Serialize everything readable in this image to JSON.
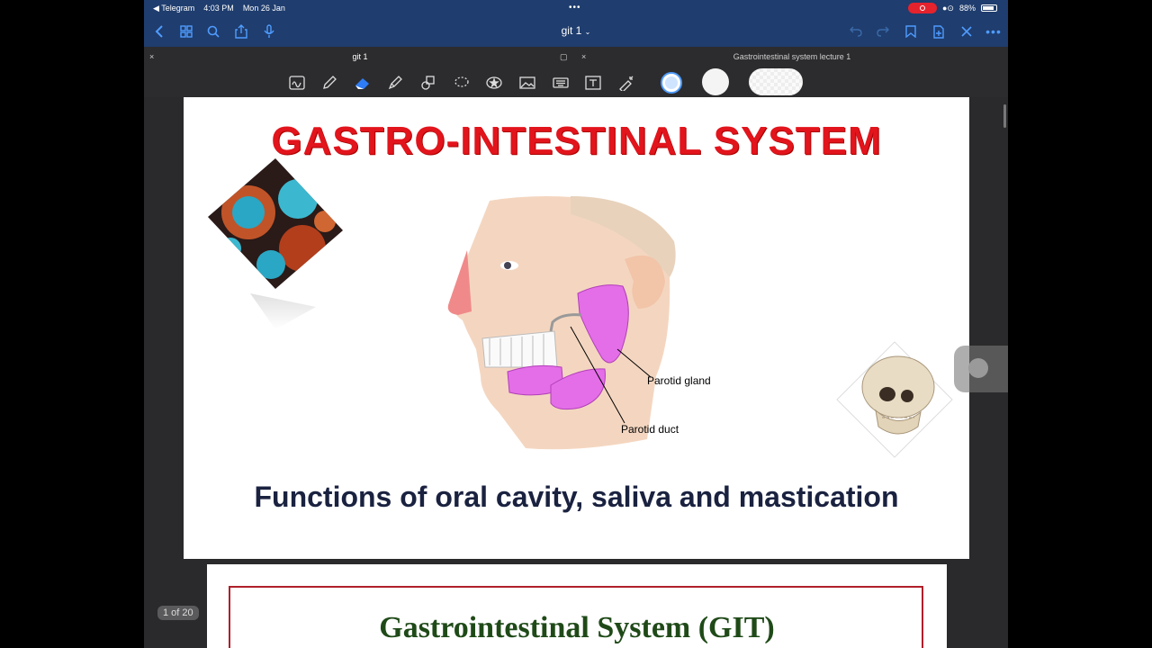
{
  "status_bar": {
    "back_app": "◀ Telegram",
    "time": "4:03 PM",
    "date": "Mon 26 Jan",
    "battery": "88%"
  },
  "nav": {
    "document_title": "git 1"
  },
  "tabs": {
    "active": "git 1",
    "other": "Gastrointestinal system lecture 1"
  },
  "slide1": {
    "title": "GASTRO-INTESTINAL SYSTEM",
    "label_gland": "Parotid gland",
    "label_duct": "Parotid duct",
    "subtitle": "Functions of oral cavity, saliva and mastication"
  },
  "slide2": {
    "title": "Gastrointestinal System (GIT)"
  },
  "page_indicator": "1 of 20",
  "colors": {
    "nav_bg": "#1f3d6e",
    "accent": "#4f9cff",
    "title_red": "#e2141c"
  }
}
